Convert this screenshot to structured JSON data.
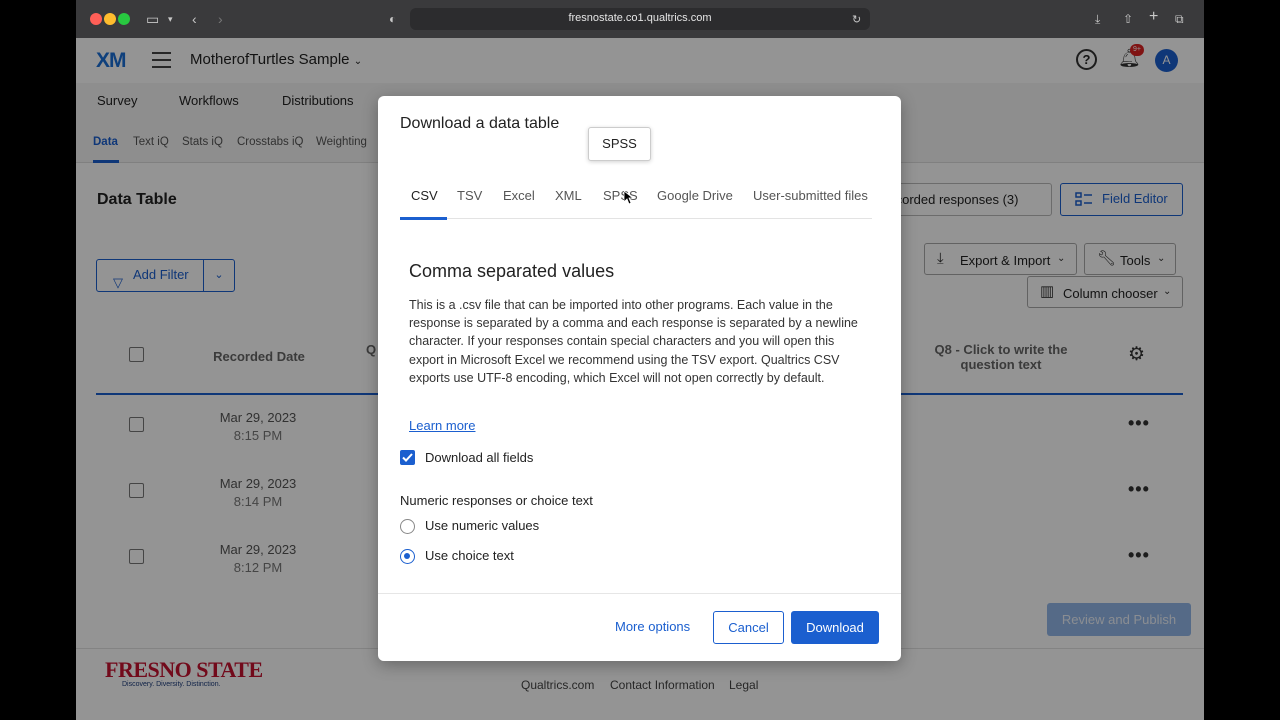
{
  "browser": {
    "url": "fresnostate.co1.qualtrics.com"
  },
  "header": {
    "logo": "XM",
    "project": "MotherofTurtles Sample",
    "notification_badge": "9+",
    "avatar_initial": "A"
  },
  "main_tabs": [
    "Survey",
    "Workflows",
    "Distributions"
  ],
  "sub_tabs": [
    "Data",
    "Text iQ",
    "Stats iQ",
    "Crosstabs iQ",
    "Weighting"
  ],
  "data_table": {
    "title": "Data Table",
    "recorded_responses": "Recorded responses (3)",
    "field_editor": "Field Editor",
    "add_filter": "Add Filter",
    "export_import": "Export & Import",
    "tools": "Tools",
    "column_chooser": "Column chooser",
    "col_recorded_date": "Recorded Date",
    "col_q": "Q",
    "col_q8": "Q8 - Click to write the question text",
    "rows": [
      {
        "date": "Mar 29, 2023",
        "time": "8:15 PM"
      },
      {
        "date": "Mar 29, 2023",
        "time": "8:14 PM"
      },
      {
        "date": "Mar 29, 2023",
        "time": "8:12 PM"
      }
    ],
    "review_publish": "Review and Publish"
  },
  "footer": {
    "brand": "FRESNO STATE",
    "tagline": "Discovery. Diversity. Distinction.",
    "links": [
      "Qualtrics.com",
      "Contact Information",
      "Legal"
    ]
  },
  "modal": {
    "title": "Download a data table",
    "tooltip": "SPSS",
    "tabs": [
      "CSV",
      "TSV",
      "Excel",
      "XML",
      "SPSS",
      "Google Drive",
      "User-submitted files"
    ],
    "active_tab": "CSV",
    "heading": "Comma separated values",
    "description": "This is a .csv file that can be imported into other programs. Each value in the response is separated by a comma and each response is separated by a newline character. If your responses contain special characters and you will open this export in Microsoft Excel we recommend using the TSV export. Qualtrics CSV exports use UTF-8 encoding, which Excel will not open correctly by default.",
    "learn_more": "Learn more",
    "download_all_fields": "Download all fields",
    "download_all_checked": true,
    "numeric_label": "Numeric responses or choice text",
    "options": [
      "Use numeric values",
      "Use choice text"
    ],
    "selected_option": "Use choice text",
    "more_options": "More options",
    "cancel": "Cancel",
    "download": "Download"
  },
  "colors": {
    "accent": "#1b5fcf",
    "brand_red": "#c41230"
  }
}
